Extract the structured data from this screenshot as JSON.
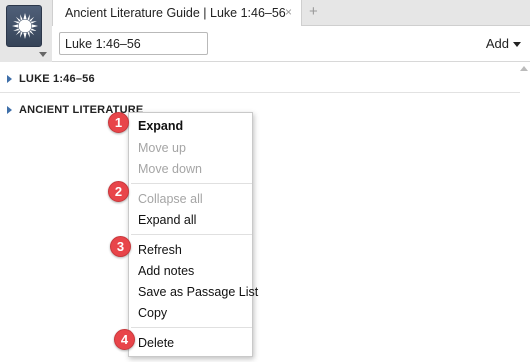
{
  "tab": {
    "title": "Ancient Literature Guide | Luke 1:46–56",
    "close_glyph": "×",
    "new_tab_glyph": "+"
  },
  "toolbar": {
    "reference_value": "Luke 1:46–56",
    "add_label": "Add"
  },
  "sections": [
    {
      "label": "LUKE 1:46–56"
    },
    {
      "label": "ANCIENT LITERATURE"
    }
  ],
  "context_menu": {
    "items": [
      {
        "label": "Expand",
        "enabled": true,
        "bold": true
      },
      {
        "label": "Move up",
        "enabled": false
      },
      {
        "label": "Move down",
        "enabled": false
      },
      {
        "label": "Collapse all",
        "enabled": false
      },
      {
        "label": "Expand all",
        "enabled": true
      },
      {
        "label": "Refresh",
        "enabled": true
      },
      {
        "label": "Add notes",
        "enabled": true
      },
      {
        "label": "Save as Passage List",
        "enabled": true
      },
      {
        "label": "Copy",
        "enabled": true
      },
      {
        "label": "Delete",
        "enabled": true
      }
    ]
  },
  "callouts": [
    "1",
    "2",
    "3",
    "4"
  ],
  "colors": {
    "logo": "#3f4d66",
    "expander": "#3f6fa9",
    "callout": "#e8454a",
    "disabled_text": "#a5a5a5"
  },
  "icons": {
    "logo": "sunburst-logo-icon",
    "expander": "triangle-right-icon",
    "add_caret": "chevron-down-icon"
  }
}
